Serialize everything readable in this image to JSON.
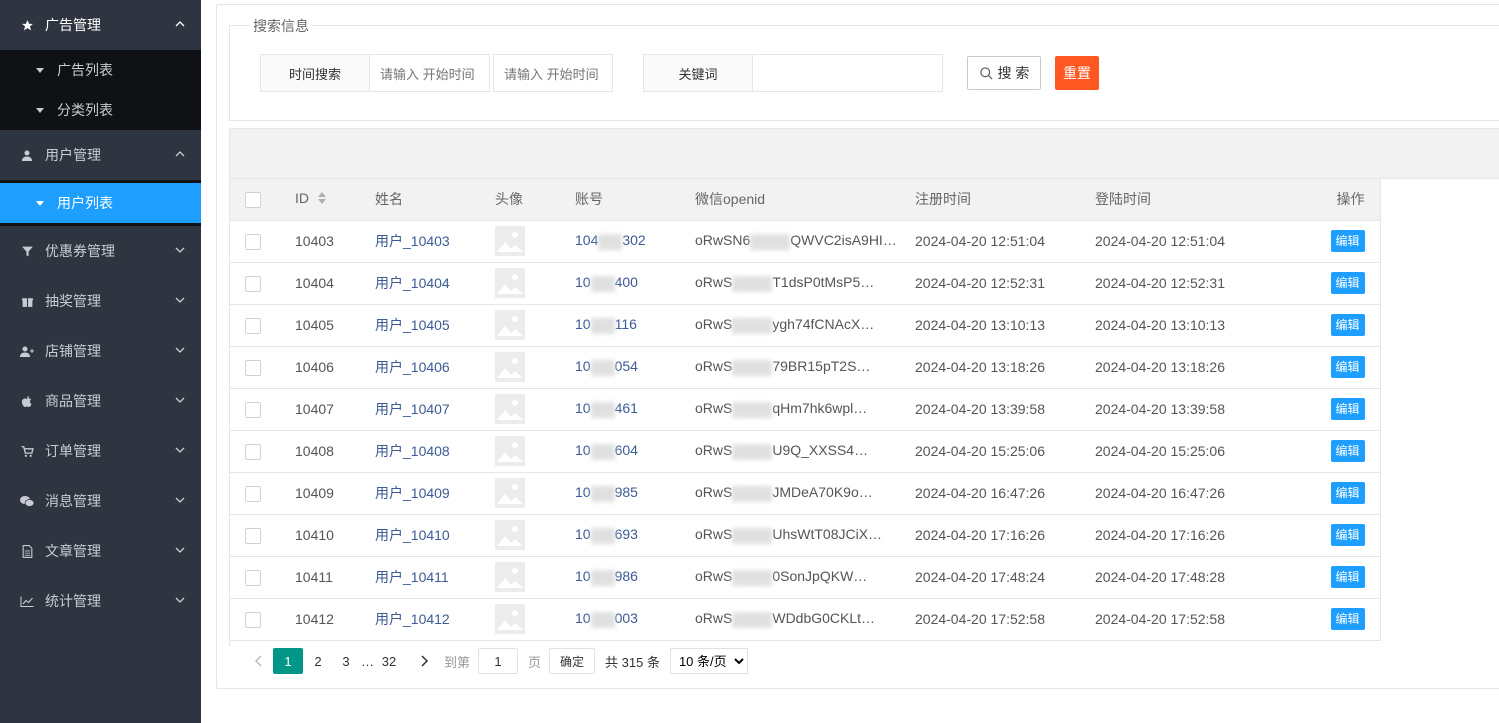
{
  "sidebar": {
    "groups": [
      {
        "label": "广告管理",
        "icon": "star-icon",
        "children": [
          "广告列表",
          "分类列表"
        ]
      },
      {
        "label": "用户管理",
        "icon": "user-icon",
        "children": [
          "用户列表"
        ]
      },
      {
        "label": "优惠券管理",
        "icon": "filter-icon",
        "children": []
      },
      {
        "label": "抽奖管理",
        "icon": "gift-icon",
        "children": []
      },
      {
        "label": "店铺管理",
        "icon": "user-plus-icon",
        "children": []
      },
      {
        "label": "商品管理",
        "icon": "apple-icon",
        "children": []
      },
      {
        "label": "订单管理",
        "icon": "cart-icon",
        "children": []
      },
      {
        "label": "消息管理",
        "icon": "wechat-icon",
        "children": []
      },
      {
        "label": "文章管理",
        "icon": "file-icon",
        "children": []
      },
      {
        "label": "统计管理",
        "icon": "chart-line-icon",
        "children": []
      }
    ]
  },
  "search": {
    "legend": "搜索信息",
    "time_label": "时间搜索",
    "start_placeholder": "请输入 开始时间",
    "end_placeholder": "请输入 开始时间",
    "keyword_label": "关键词",
    "keyword_value": "",
    "search_button": "搜 索",
    "reset_button": "重置"
  },
  "table": {
    "headers": [
      "ID",
      "姓名",
      "头像",
      "账号",
      "微信openid",
      "注册时间",
      "登陆时间",
      "操作"
    ],
    "edit_label": "编辑",
    "rows": [
      {
        "id": "10403",
        "name": "用户_10403",
        "acct_a": "104",
        "acct_b": "302",
        "oid_a": "oRwSN6",
        "oid_b": "QWVC2isA9HI…",
        "reg": "2024-04-20 12:51:04",
        "login": "2024-04-20 12:51:04"
      },
      {
        "id": "10404",
        "name": "用户_10404",
        "acct_a": "10",
        "acct_b": "400",
        "oid_a": "oRwS",
        "oid_b": "T1dsP0tMsP5…",
        "reg": "2024-04-20 12:52:31",
        "login": "2024-04-20 12:52:31"
      },
      {
        "id": "10405",
        "name": "用户_10405",
        "acct_a": "10",
        "acct_b": "116",
        "oid_a": "oRwS",
        "oid_b": "ygh74fCNAcX…",
        "reg": "2024-04-20 13:10:13",
        "login": "2024-04-20 13:10:13"
      },
      {
        "id": "10406",
        "name": "用户_10406",
        "acct_a": "10",
        "acct_b": "054",
        "oid_a": "oRwS",
        "oid_b": "79BR15pT2S…",
        "reg": "2024-04-20 13:18:26",
        "login": "2024-04-20 13:18:26"
      },
      {
        "id": "10407",
        "name": "用户_10407",
        "acct_a": "10",
        "acct_b": "461",
        "oid_a": "oRwS",
        "oid_b": "qHm7hk6wpl…",
        "reg": "2024-04-20 13:39:58",
        "login": "2024-04-20 13:39:58"
      },
      {
        "id": "10408",
        "name": "用户_10408",
        "acct_a": "10",
        "acct_b": "604",
        "oid_a": "oRwS",
        "oid_b": "U9Q_XXSS4…",
        "reg": "2024-04-20 15:25:06",
        "login": "2024-04-20 15:25:06"
      },
      {
        "id": "10409",
        "name": "用户_10409",
        "acct_a": "10",
        "acct_b": "985",
        "oid_a": "oRwS",
        "oid_b": "JMDeA70K9o…",
        "reg": "2024-04-20 16:47:26",
        "login": "2024-04-20 16:47:26"
      },
      {
        "id": "10410",
        "name": "用户_10410",
        "acct_a": "10",
        "acct_b": "693",
        "oid_a": "oRwS",
        "oid_b": "UhsWtT08JCiX…",
        "reg": "2024-04-20 17:16:26",
        "login": "2024-04-20 17:16:26"
      },
      {
        "id": "10411",
        "name": "用户_10411",
        "acct_a": "10",
        "acct_b": "986",
        "oid_a": "oRwS",
        "oid_b": "0SonJpQKW…",
        "reg": "2024-04-20 17:48:24",
        "login": "2024-04-20 17:48:28"
      },
      {
        "id": "10412",
        "name": "用户_10412",
        "acct_a": "10",
        "acct_b": "003",
        "oid_a": "oRwS",
        "oid_b": "WDdbG0CKLt…",
        "reg": "2024-04-20 17:52:58",
        "login": "2024-04-20 17:52:58"
      }
    ]
  },
  "pagination": {
    "pages": [
      "1",
      "2",
      "3"
    ],
    "ellipsis": "…",
    "last_page": "32",
    "goto_label": "到第",
    "goto_value": "1",
    "page_unit": "页",
    "confirm": "确定",
    "total": "共 315 条",
    "page_size": "10 条/页"
  },
  "colors": {
    "sidebar_bg": "#2f3540",
    "active": "#1e9fff",
    "reset": "#ff5722",
    "current_page": "#009688"
  }
}
